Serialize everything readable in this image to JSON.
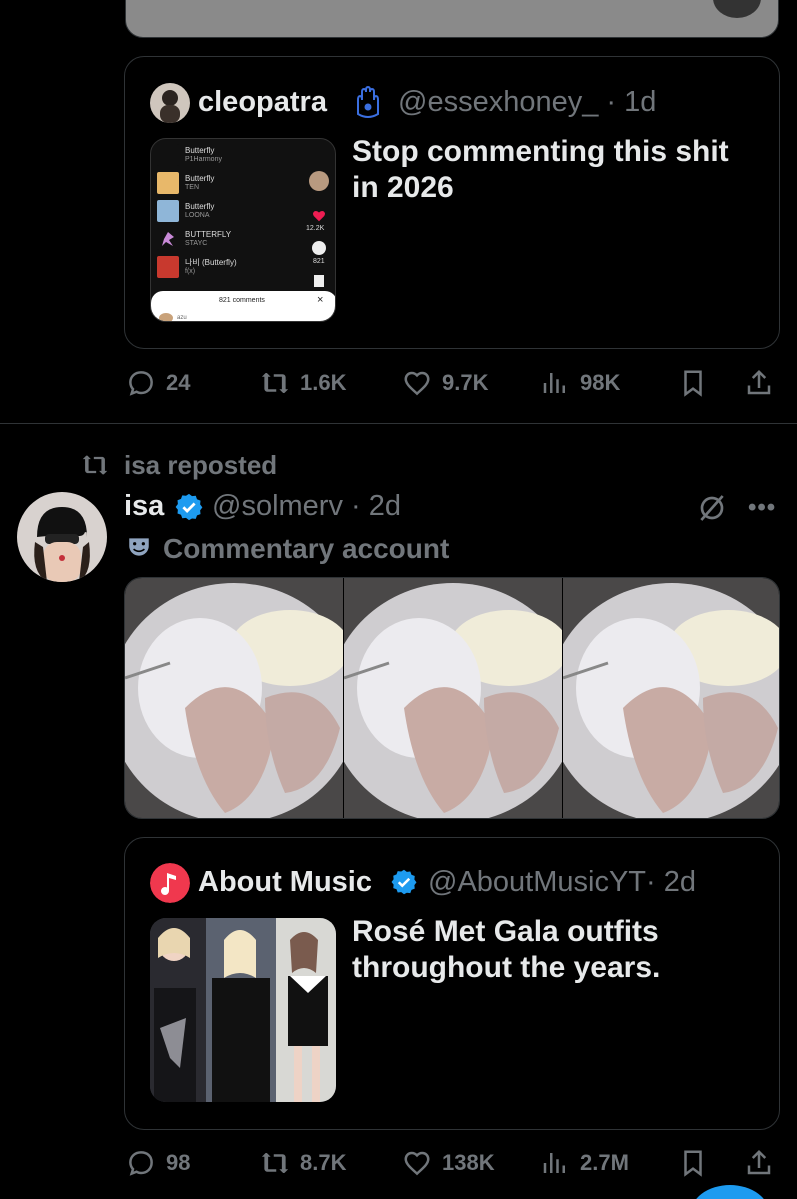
{
  "post1": {
    "quote": {
      "name": "cleopatra",
      "handle": "@essexhoney_",
      "time": "· 1d",
      "text": "Stop commenting this shit in 2026",
      "thumbnail": {
        "songs": [
          {
            "title": "Butterfly",
            "artist": "P1Harmony"
          },
          {
            "title": "Butterfly",
            "artist": "TEN"
          },
          {
            "title": "Butterfly",
            "artist": "LOONA"
          },
          {
            "title": "BUTTERFLY",
            "artist": "STAYC"
          },
          {
            "title": "나비 (Butterfly)",
            "artist": "f(x)"
          }
        ],
        "likes": "12.2K",
        "comments": "821",
        "comments_bar": "821 comments",
        "commenter": "azu"
      }
    },
    "actions": {
      "replies": "24",
      "reposts": "1.6K",
      "likes": "9.7K",
      "views": "98K"
    }
  },
  "post2": {
    "repost_label": "isa reposted",
    "name": "isa",
    "handle": "@solmerv",
    "time": "· 2d",
    "label": "Commentary account",
    "quote": {
      "name": "About Music",
      "handle": "@AboutMusicYT",
      "time": "· 2d",
      "text": "Rosé Met Gala outfits throughout the years."
    },
    "actions": {
      "replies": "98",
      "reposts": "8.7K",
      "likes": "138K",
      "views": "2.7M"
    }
  },
  "colors": {
    "background": "#000000",
    "text": "#e7e9ea",
    "muted": "#71767b",
    "border": "#2f3336",
    "verified": "#1d9bf0",
    "accent": "#1d9bf0"
  },
  "icons": [
    "reply-icon",
    "repost-icon",
    "like-icon",
    "views-icon",
    "bookmark-icon",
    "share-icon",
    "verified-icon",
    "hamsa-icon",
    "grok-icon",
    "more-icon",
    "theater-masks-icon",
    "music-note-icon"
  ]
}
